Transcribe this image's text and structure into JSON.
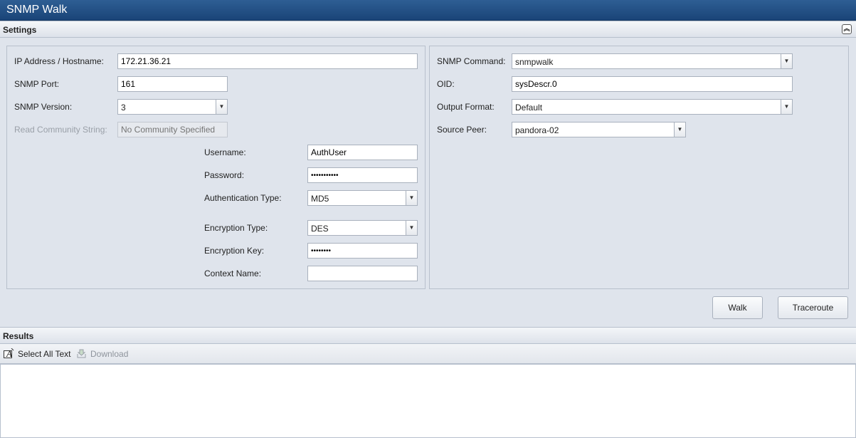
{
  "app": {
    "title": "SNMP Walk"
  },
  "settings": {
    "header": "Settings",
    "collapse_icon": "collapse-up-icon",
    "left": {
      "ip_label": "IP Address / Hostname:",
      "ip_value": "172.21.36.21",
      "port_label": "SNMP Port:",
      "port_value": "161",
      "version_label": "SNMP Version:",
      "version_value": "3",
      "community_label": "Read Community String:",
      "community_placeholder": "No Community Specified",
      "username_label": "Username:",
      "username_value": "AuthUser",
      "password_label": "Password:",
      "password_value": "•••••••••••",
      "auth_type_label": "Authentication Type:",
      "auth_type_value": "MD5",
      "enc_type_label": "Encryption Type:",
      "enc_type_value": "DES",
      "enc_key_label": "Encryption Key:",
      "enc_key_value": "••••••••",
      "context_label": "Context Name:",
      "context_value": ""
    },
    "right": {
      "command_label": "SNMP Command:",
      "command_value": "snmpwalk",
      "oid_label": "OID:",
      "oid_value": "sysDescr.0",
      "format_label": "Output Format:",
      "format_value": "Default",
      "peer_label": "Source Peer:",
      "peer_value": "pandora-02"
    },
    "buttons": {
      "walk": "Walk",
      "traceroute": "Traceroute"
    }
  },
  "results": {
    "header": "Results",
    "toolbar": {
      "select_all": "Select All Text",
      "select_all_icon": "text-select-icon",
      "download": "Download",
      "download_icon": "download-icon"
    },
    "content": ""
  }
}
